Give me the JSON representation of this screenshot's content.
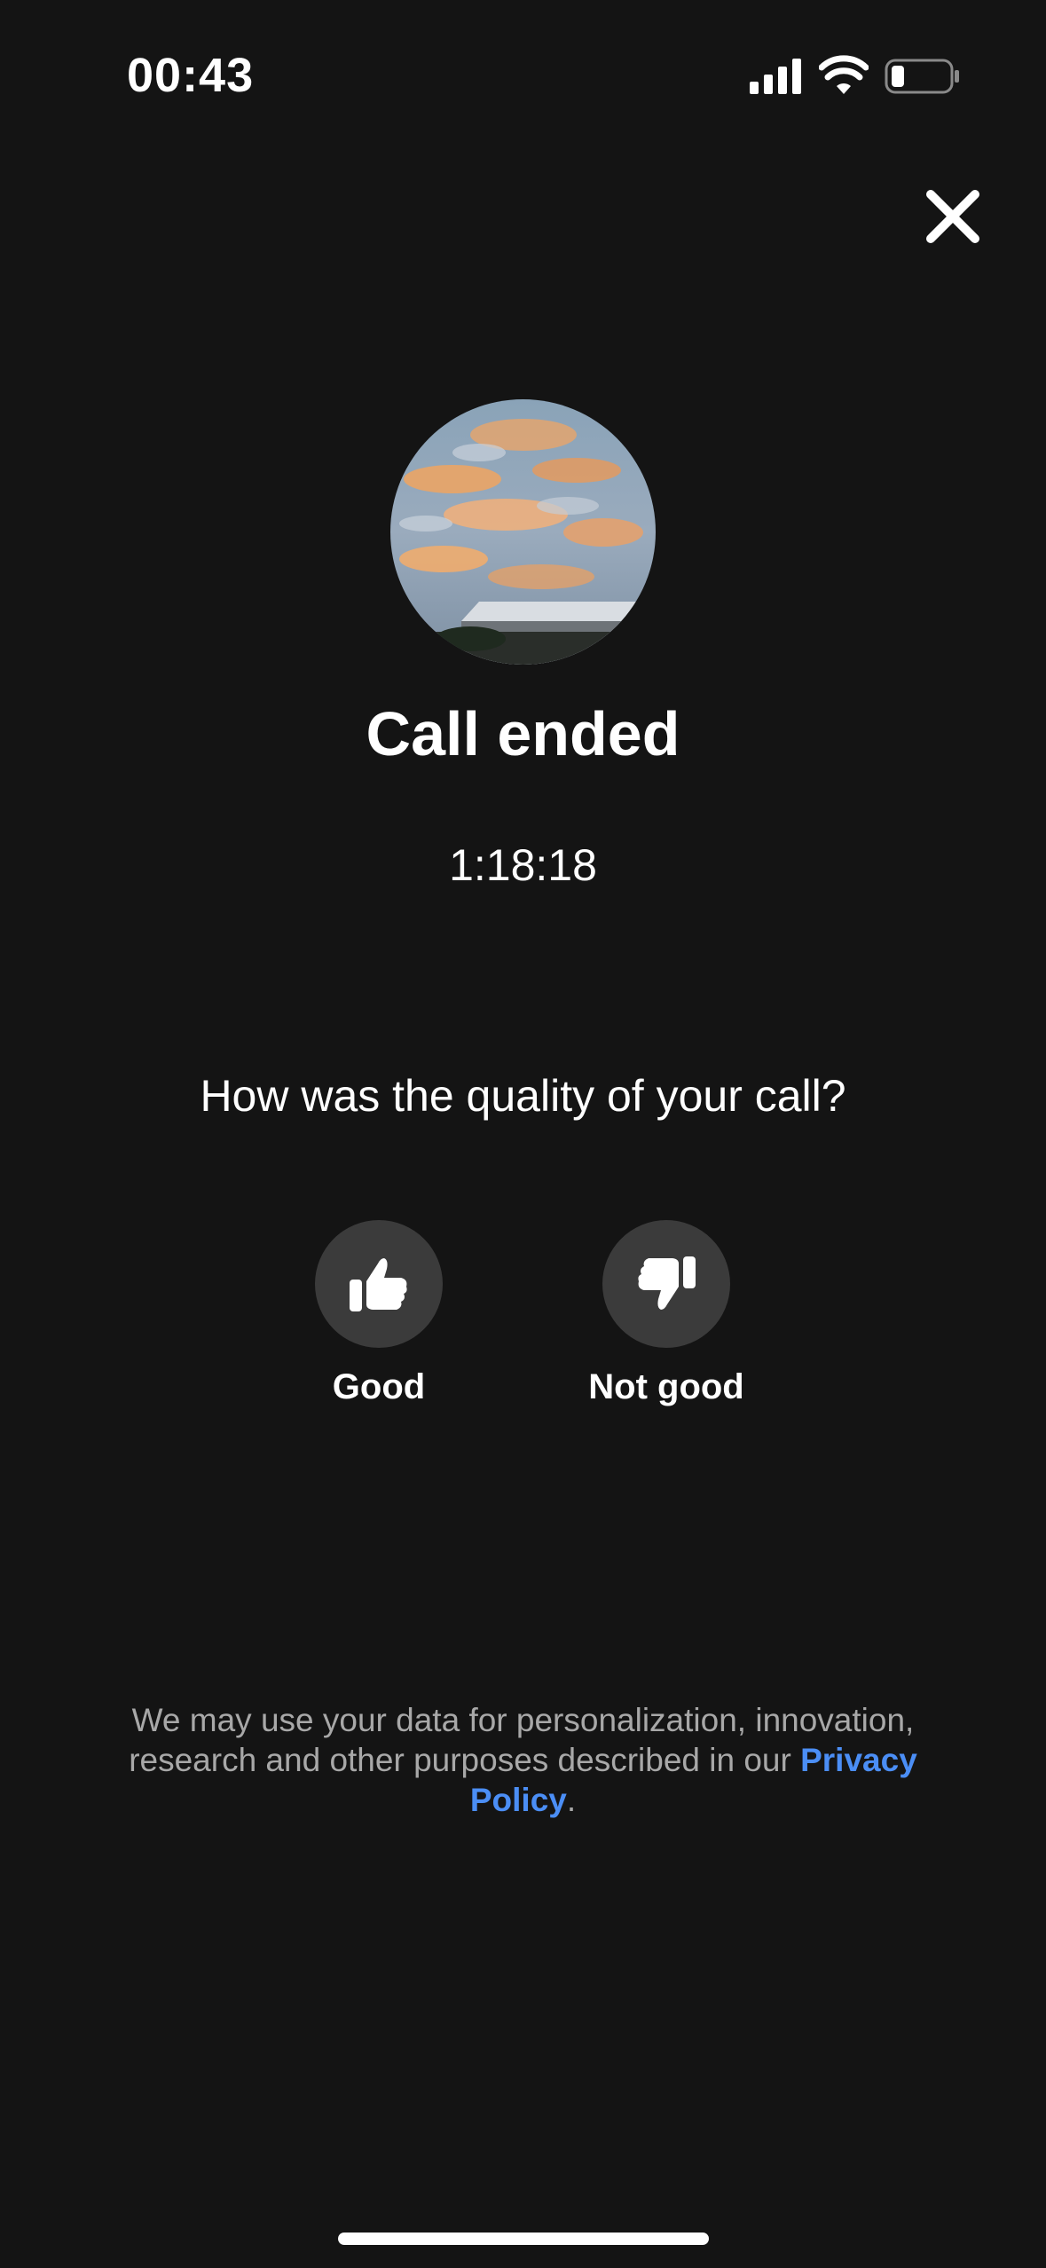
{
  "status_bar": {
    "time": "00:43",
    "icons": [
      "signal-icon",
      "wifi-icon",
      "battery-icon"
    ],
    "battery_level": 0.15
  },
  "close": {
    "icon": "close-icon"
  },
  "call": {
    "title": "Call ended",
    "duration": "1:18:18"
  },
  "feedback": {
    "question": "How was the quality of your call?",
    "options": [
      {
        "label": "Good",
        "icon": "thumbs-up-icon"
      },
      {
        "label": "Not good",
        "icon": "thumbs-down-icon"
      }
    ]
  },
  "disclaimer": {
    "text": "We may use your data for personalization, innovation, research and other purposes described in our ",
    "link": "Privacy Policy",
    "suffix": "."
  },
  "colors": {
    "background": "#141414",
    "button_bg": "#3b3b3b",
    "link": "#4b8ef5",
    "muted_text": "#a8a8a8"
  }
}
